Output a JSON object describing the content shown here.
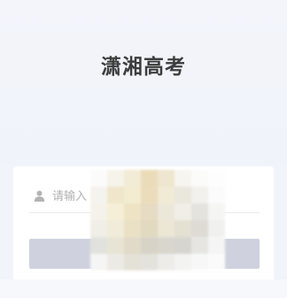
{
  "app": {
    "title": "潇湘高考"
  },
  "login": {
    "username_placeholder": "请输入",
    "username_value": "",
    "submit_label": ""
  },
  "icons": {
    "user": "user-icon"
  },
  "colors": {
    "background": "#f1f4fa",
    "card": "#ffffff",
    "button": "#cfd2de",
    "title": "#3d3d3d",
    "placeholder": "#b0b0b0"
  }
}
